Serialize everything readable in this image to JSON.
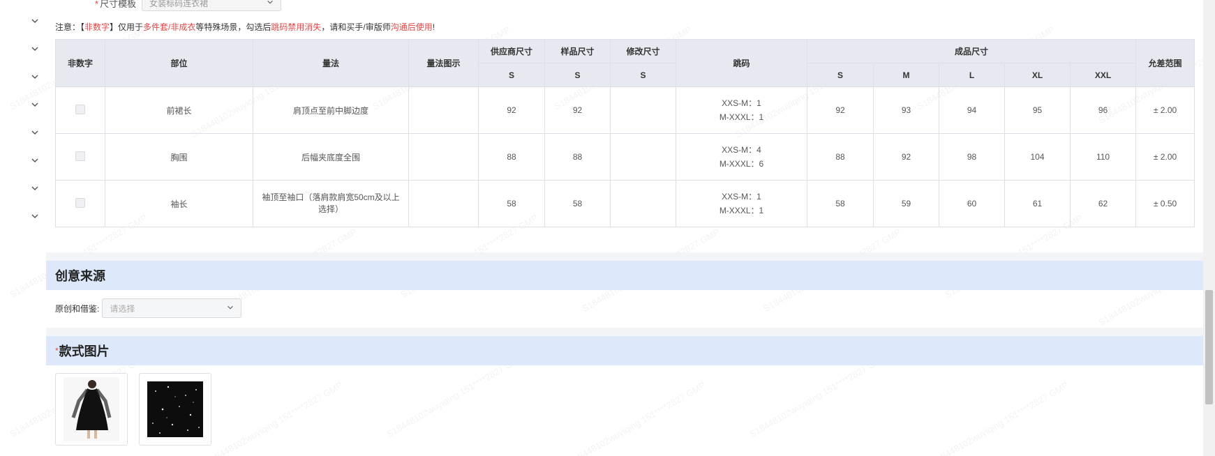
{
  "size_template": {
    "label": "尺寸模板",
    "value": "女装标码连衣裙"
  },
  "note": {
    "prefix": "注意：【",
    "red1": "非数字",
    "mid1": "】仅用于",
    "red2": "多件套/非成衣",
    "mid2": "等特殊场景，勾选后",
    "red3": "跳码禁用消失",
    "mid3": "，请和买手/审版师",
    "red4": "沟通后使用",
    "suffix": "!"
  },
  "table": {
    "headers": {
      "non_numeric": "非数字",
      "part": "部位",
      "method": "量法",
      "method_img": "量法图示",
      "supplier_size": "供应商尺寸",
      "sample_size": "样品尺寸",
      "modify_size": "修改尺寸",
      "jump_code": "跳码",
      "finished_size": "成品尺寸",
      "tolerance": "允差范围",
      "supplier_sub": "S",
      "sample_sub": "S",
      "modify_sub": "S",
      "sizes": [
        "S",
        "M",
        "L",
        "XL",
        "XXL"
      ]
    },
    "rows": [
      {
        "part": "前裙长",
        "method": "肩顶点至前中脚边度",
        "supplier": "92",
        "sample": "92",
        "modify": "",
        "code1": "XXS-M：1",
        "code2": "M-XXXL：1",
        "finished": [
          "92",
          "93",
          "94",
          "95",
          "96"
        ],
        "tolerance": "± 2.00"
      },
      {
        "part": "胸围",
        "method": "后幅夹底度全围",
        "supplier": "88",
        "sample": "88",
        "modify": "",
        "code1": "XXS-M：4",
        "code2": "M-XXXL：6",
        "finished": [
          "88",
          "92",
          "98",
          "104",
          "110"
        ],
        "tolerance": "± 2.00"
      },
      {
        "part": "袖长",
        "method": "袖顶至袖口（落肩款肩宽50cm及以上选择）",
        "supplier": "58",
        "sample": "58",
        "modify": "",
        "code1": "XXS-M：1",
        "code2": "M-XXXL：1",
        "finished": [
          "58",
          "59",
          "60",
          "61",
          "62"
        ],
        "tolerance": "± 0.50"
      }
    ]
  },
  "creative": {
    "title": "创意来源",
    "field_label": "原创和借鉴:",
    "placeholder": "请选择"
  },
  "style_images": {
    "title": "款式图片",
    "required_mark": "*",
    "images": [
      "black-dress-photo",
      "sequin-fabric-swatch"
    ]
  },
  "watermark": "S18448102wuyiqing 151****2827 GMP",
  "colors": {
    "accent_red": "#e54545",
    "section_bg": "#dde9fb",
    "header_bg": "#e6eaf0"
  }
}
